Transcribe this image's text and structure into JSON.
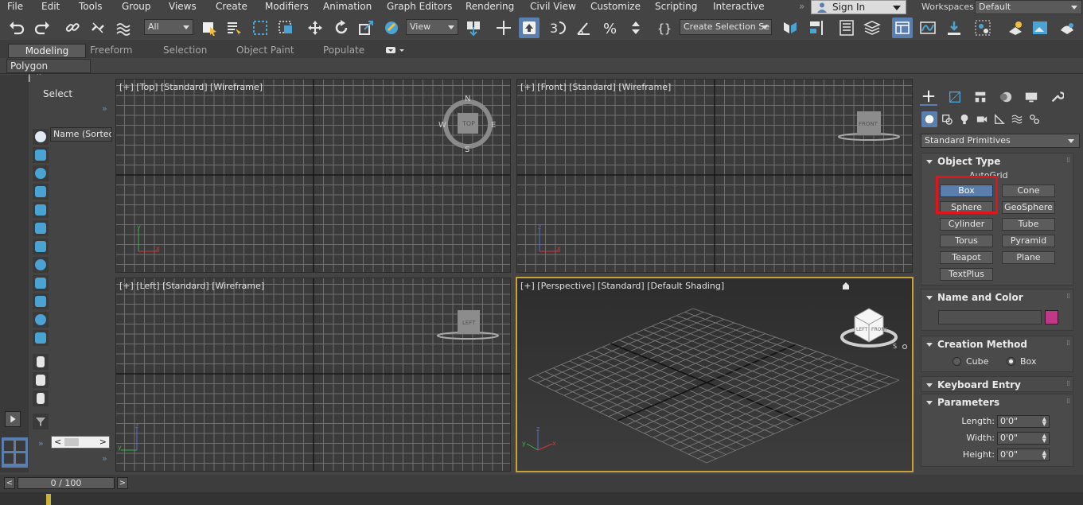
{
  "menu": [
    "File",
    "Edit",
    "Tools",
    "Group",
    "Views",
    "Create",
    "Modifiers",
    "Animation",
    "Graph Editors",
    "Rendering",
    "Civil View",
    "Customize",
    "Scripting",
    "Interactive"
  ],
  "signin": {
    "label": "Sign In"
  },
  "workspaces": {
    "label": "Workspaces:",
    "value": "Default"
  },
  "toolbar": {
    "filter_value": "All",
    "refcoord_value": "View",
    "selection_set_placeholder": "Create Selection Se"
  },
  "ribbon": {
    "tabs": [
      "Modeling",
      "Freeform",
      "Selection",
      "Object Paint",
      "Populate"
    ],
    "sub": "Polygon Modeling"
  },
  "explorer": {
    "select_label": "Select",
    "name_column": "Name (Sorted A"
  },
  "viewports": {
    "top": {
      "label": "[+] [Top] [Standard] [Wireframe]",
      "cube": "TOP",
      "compass": [
        "N",
        "S",
        "W",
        "E"
      ]
    },
    "front": {
      "label": "[+] [Front] [Standard] [Wireframe]",
      "cube": "FRONT"
    },
    "left": {
      "label": "[+] [Left] [Standard] [Wireframe]",
      "cube": "LEFT"
    },
    "persp": {
      "label": "[+] [Perspective] [Standard] [Default Shading]",
      "cube_front": "FRONT",
      "cube_left": "LEFT",
      "cube_s": "S"
    }
  },
  "command_panel": {
    "category": "Standard Primitives",
    "object_type": {
      "title": "Object Type",
      "autogrid": "AutoGrid",
      "buttons": [
        "Box",
        "Cone",
        "Sphere",
        "GeoSphere",
        "Cylinder",
        "Tube",
        "Torus",
        "Pyramid",
        "Teapot",
        "Plane",
        "TextPlus"
      ],
      "active": "Box"
    },
    "name_color": {
      "title": "Name and Color",
      "color": "#c03888"
    },
    "creation_method": {
      "title": "Creation Method",
      "options": [
        "Cube",
        "Box"
      ],
      "selected": "Box"
    },
    "keyboard_entry": {
      "title": "Keyboard Entry"
    },
    "parameters": {
      "title": "Parameters",
      "length_label": "Length:",
      "length": "0'0\"",
      "width_label": "Width:",
      "width": "0'0\"",
      "height_label": "Height:",
      "height": "0'0\""
    }
  },
  "timeline": {
    "frame": "0 / 100",
    "prev": "<",
    "next": ">"
  },
  "colors": {
    "accent": "#5a7fae",
    "highlight": "#e0141b",
    "active_viewport": "#c9a33a"
  }
}
